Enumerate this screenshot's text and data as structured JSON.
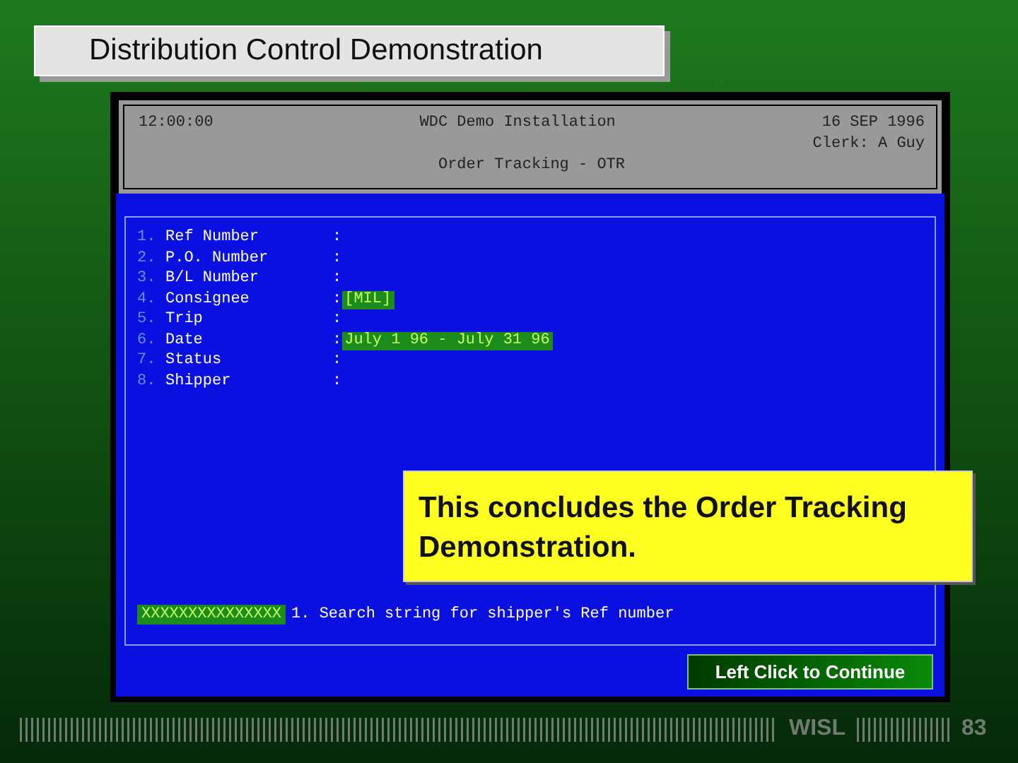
{
  "slide": {
    "title": "Distribution Control Demonstration",
    "footer_brand": "WISL",
    "page_number": "83"
  },
  "terminal": {
    "header": {
      "time": "12:00:00",
      "installation": "WDC Demo Installation",
      "date": "16 SEP 1996",
      "clerk": "Clerk: A Guy",
      "screen": "Order Tracking - OTR"
    },
    "fields": [
      {
        "number": "1.",
        "label": "Ref Number",
        "separator": ":"
      },
      {
        "number": "2.",
        "label": "P.O. Number",
        "separator": ":"
      },
      {
        "number": "3.",
        "label": "B/L Number",
        "separator": ":"
      },
      {
        "number": "4.",
        "label": "Consignee",
        "separator": ":",
        "value": "[MIL]"
      },
      {
        "number": "5.",
        "label": "Trip",
        "separator": ":"
      },
      {
        "number": "6.",
        "label": "Date",
        "separator": ":",
        "value": "July 1 96 - July 31 96"
      },
      {
        "number": "7.",
        "label": "Status",
        "separator": ":"
      },
      {
        "number": "8.",
        "label": "Shipper",
        "separator": ":"
      }
    ],
    "input": {
      "value": "XXXXXXXXXXXXXXX",
      "hint": "1. Search string for shipper's Ref number"
    }
  },
  "callout": "This concludes the Order Tracking Demonstration.",
  "continue_button": "Left Click to Continue"
}
